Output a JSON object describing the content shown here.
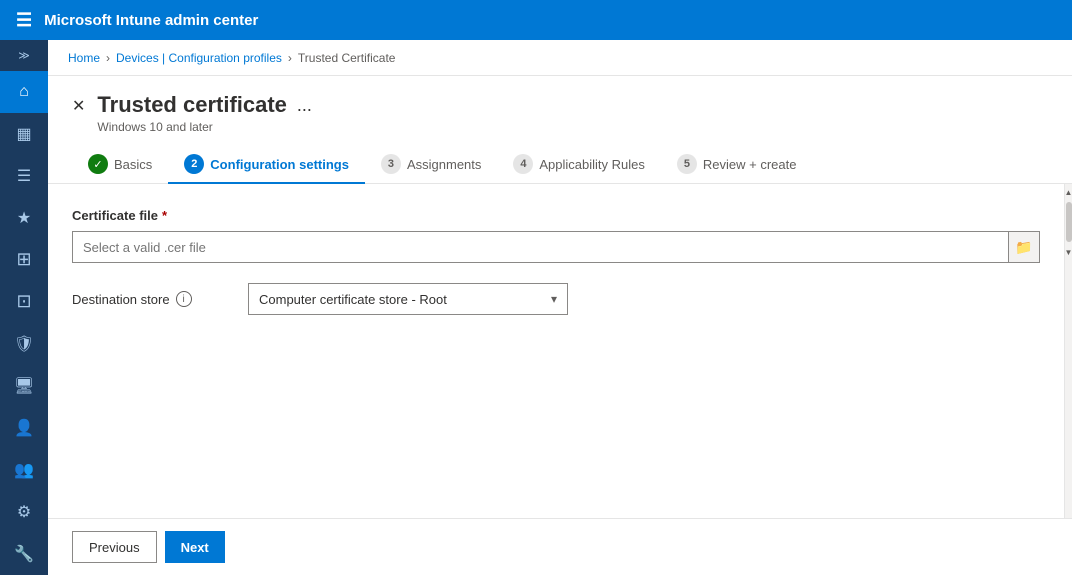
{
  "app": {
    "title": "Microsoft Intune admin center"
  },
  "breadcrumb": {
    "home": "Home",
    "devices": "Devices | Configuration profiles",
    "current": "Trusted Certificate"
  },
  "panel": {
    "title": "Trusted certificate",
    "ellipsis": "...",
    "subtitle": "Windows 10 and later"
  },
  "tabs": [
    {
      "id": "basics",
      "label": "Basics",
      "num": null,
      "check": true,
      "active": false
    },
    {
      "id": "config",
      "label": "Configuration settings",
      "num": "2",
      "check": false,
      "active": true
    },
    {
      "id": "assignments",
      "label": "Assignments",
      "num": "3",
      "check": false,
      "active": false
    },
    {
      "id": "applicability",
      "label": "Applicability Rules",
      "num": "4",
      "check": false,
      "active": false
    },
    {
      "id": "review",
      "label": "Review + create",
      "num": "5",
      "check": false,
      "active": false
    }
  ],
  "form": {
    "certificate_file_label": "Certificate file",
    "certificate_file_placeholder": "Select a valid .cer file",
    "destination_store_label": "Destination store",
    "destination_store_value": "Computer certificate store - Root"
  },
  "footer": {
    "previous_label": "Previous",
    "next_label": "Next"
  },
  "sidebar": {
    "items": [
      {
        "id": "expand",
        "icon": "≫"
      },
      {
        "id": "home",
        "icon": "⌂"
      },
      {
        "id": "dashboard",
        "icon": "▦"
      },
      {
        "id": "list",
        "icon": "☰"
      },
      {
        "id": "star",
        "icon": "★"
      },
      {
        "id": "devices",
        "icon": "⊞"
      },
      {
        "id": "apps",
        "icon": "⊡"
      },
      {
        "id": "security",
        "icon": "🛡"
      },
      {
        "id": "monitor",
        "icon": "⊟"
      },
      {
        "id": "users",
        "icon": "👤"
      },
      {
        "id": "groups",
        "icon": "👥"
      },
      {
        "id": "settings",
        "icon": "⚙"
      },
      {
        "id": "tools",
        "icon": "🔧"
      }
    ]
  }
}
